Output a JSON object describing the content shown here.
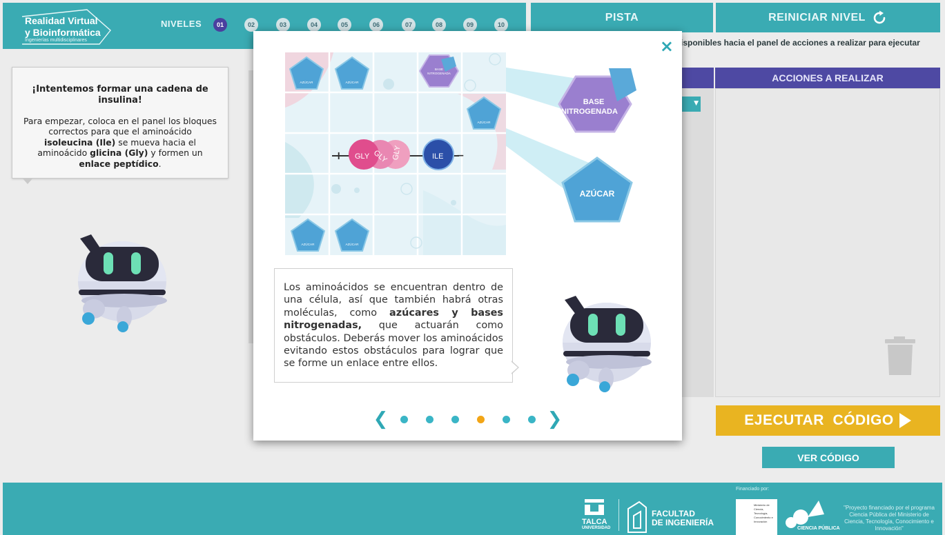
{
  "header": {
    "logo_line1": "Realidad Virtual",
    "logo_line2": "y Bioinformática",
    "logo_sub": "Ingenierías multidisciplinares",
    "niveles_label": "NIVELES",
    "levels": [
      "01",
      "02",
      "03",
      "04",
      "05",
      "06",
      "07",
      "08",
      "09",
      "10"
    ],
    "active_level": "01",
    "pista_label": "PISTA",
    "reiniciar_label": "REINICIAR NIVEL"
  },
  "instructions_partial": "isponibles hacia el panel de acciones a realizar para ejecutar",
  "acciones_header": "ACCIONES A REALIZAR",
  "ejecutar_label": "EJECUTAR  CÓDIGO",
  "ver_codigo_label": "VER CÓDIGO",
  "speech": {
    "title": "¡Intentemos formar una cadena de insulina!",
    "p1": "Para empezar, coloca en el panel los bloques correctos para que el aminoácido ",
    "b1": "isoleucina (Ile)",
    "p2": " se mueva hacia el aminoácido ",
    "b2": "glicina (Gly)",
    "p3": " y formen un ",
    "b3": "enlace peptídico",
    "p4": "."
  },
  "modal": {
    "close_label": "×",
    "text_p1": "Los aminoácidos se encuentran dentro de una célula, así que también habrá otras moléculas, como ",
    "text_b1": "azúcares y bases nitrogenadas,",
    "text_p2": " que actuarán como obstáculos. Deberás mover los aminoácidos evitando estos obstáculos para lograr que se forme un enlace entre ellos.",
    "callout_base": [
      "BASE",
      "NITROGENADA"
    ],
    "callout_azucar": "AZÚCAR",
    "board_labels": {
      "azucar": "AZÚCAR",
      "base_small": [
        "BASE",
        "NITROGENADA"
      ],
      "gly": "GLY",
      "ile": "ILE"
    },
    "pager": {
      "prev": "❮",
      "next": "❯",
      "pages": 6,
      "active_index": 3
    }
  },
  "footer": {
    "financiado": "Financiado por:",
    "talca": "TALCA",
    "talca_sub": "UNIVERSIDAD",
    "facultad_line1": "FACULTAD",
    "facultad_line2": "DE INGENIERÍA",
    "ministerio": "Ministerio de Ciencia, Tecnología, Conocimiento e Innovación",
    "ciencia": "CIENCIA PÚBLICA",
    "proyecto": "\"Proyecto financiado por el programa Ciencia Pública del Ministerio de Ciencia, Tecnología, Conocimiento e Innovación\""
  },
  "colors": {
    "teal": "#3aabb3",
    "purple_header": "#4e49a3",
    "ejecutar": "#e9b421",
    "dot": "#3ab5c6",
    "dot_active": "#f2a516",
    "azucar": "#4fa3d6",
    "base": "#9a7fcf",
    "gly": "#e04d8d",
    "ile": "#2b4fa8"
  }
}
